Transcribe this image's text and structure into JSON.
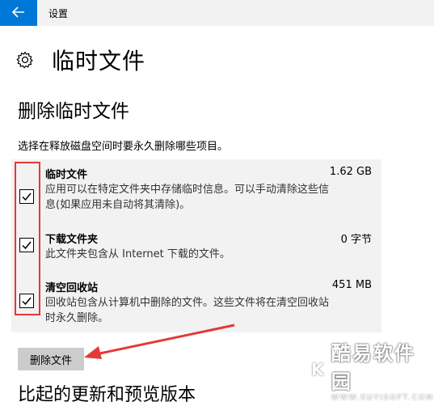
{
  "app": {
    "title": "设置"
  },
  "header": {
    "title": "临时文件"
  },
  "section": {
    "title": "删除临时文件",
    "description": "选择在释放磁盘空间时要永久删除哪些项目。"
  },
  "items": [
    {
      "name": "临时文件",
      "size": "1.62 GB",
      "checked": true,
      "desc_line1": "应用可以在特定文件夹中存储临时信息。可以手动清除这些信",
      "desc_line2": "息(如果应用未自动将其清除)。"
    },
    {
      "name": "下载文件夹",
      "size": "0 字节",
      "checked": true,
      "desc_line1": "此文件夹包含从 Internet 下载的文件。",
      "desc_line2": ""
    },
    {
      "name": "清空回收站",
      "size": "451 MB",
      "checked": true,
      "desc_line1": "回收站包含从计算机中删除的文件。这些文件将在清空回收站",
      "desc_line2": "时永久删除。"
    }
  ],
  "actions": {
    "delete_label": "删除文件"
  },
  "cutoff_heading": "比起的更新和预览版本",
  "watermark": {
    "logo": "K",
    "text": "酷易软件园",
    "url": "WWW.KUYISOFT.COM"
  },
  "colors": {
    "accent": "#0078d7",
    "highlight": "#e53935",
    "panel": "#f2f2f2"
  }
}
